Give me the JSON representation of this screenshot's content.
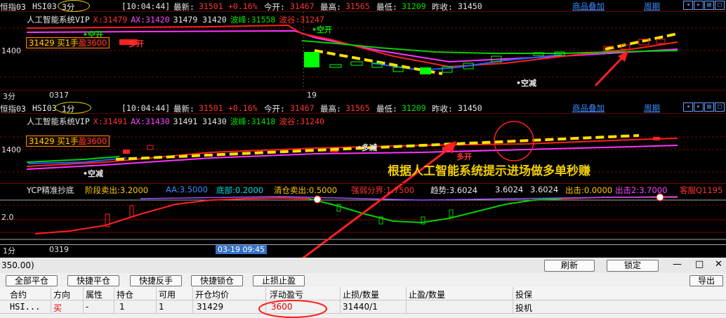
{
  "top_chart": {
    "header": {
      "symbol": "恒指03",
      "code": "HSI03",
      "period": "3分",
      "time": "[10:04:44]",
      "latest_label": "最新:",
      "latest": "31501",
      "change": "+0.16%",
      "open_label": "今开:",
      "open": "31467",
      "high_label": "最高:",
      "high": "31565",
      "low_label": "最低:",
      "low": "31209",
      "prev_label": "昨收:",
      "prev": "31450",
      "overlay_link": "商品叠加",
      "cycle_link": "周期"
    },
    "legend": {
      "name": "人工智能系统VIP",
      "x": "X:31479",
      "ax": "AX:31420",
      "vals": "31479 31420",
      "peak": "波峰:31558",
      "trough": "波谷:31247"
    },
    "position": {
      "price": "31429",
      "action": "买1手",
      "profit": "盈3600"
    },
    "y_label": "1400",
    "period_label": "3分",
    "date1": "0317",
    "date2": "19",
    "annotations": {
      "kong_kai_1": "•空开",
      "kong_kai_2": "•空开",
      "duo_kai": "多开",
      "kong_jian": "•空减"
    }
  },
  "bottom_chart": {
    "header": {
      "symbol": "恒指03",
      "code": "HSI03",
      "period": "1分",
      "time": "[10:04:44]",
      "latest_label": "最新:",
      "latest": "31501",
      "change": "+0.16%",
      "open_label": "今开:",
      "open": "31467",
      "high_label": "最高:",
      "high": "31565",
      "low_label": "最低:",
      "low": "31209",
      "prev_label": "昨收:",
      "prev": "31450",
      "overlay_link": "商品叠加",
      "cycle_link": "周期"
    },
    "legend": {
      "name": "人工智能系统VIP",
      "x": "X:31491",
      "ax": "AX:31430",
      "vals": "31491 31430",
      "peak": "波峰:31418",
      "trough": "波谷:31240"
    },
    "position": {
      "price": "31429",
      "action": "买1手",
      "profit": "盈3600"
    },
    "y_label": "1400",
    "y2_label": "2.0",
    "period_label": "1分",
    "date1": "0319",
    "date_highlight": "03-19 09:45",
    "annotations": {
      "kong_jian": "•空减",
      "duo_jian": "•多减",
      "duo_kai": "多开"
    },
    "big_annotation": "根据人工智能系统提示进场做多单秒赚",
    "indicator": {
      "name": "YCP精准抄底",
      "stage_sell": "阶段卖出:3.2000",
      "aa": "AA:3.5000",
      "bottom": "底部:0.2000",
      "clear_sell": "清仓卖出:0.5000",
      "strong_weak": "强弱分界:1.7500",
      "trend": "趋势:3.6024",
      "v1": "3.6024",
      "v2": "3.6024",
      "out": "出击:0.0000",
      "out2": "出击2:3.7000",
      "tail": "客服Q1195"
    }
  },
  "trade_panel": {
    "account_value": "350.00)",
    "refresh": "刷新",
    "lock": "锁定",
    "export": "导出",
    "buttons": [
      "全部平仓",
      "快捷平仓",
      "快捷反手",
      "快捷锁仓",
      "止损止盈"
    ],
    "columns": [
      "合约",
      "方向",
      "属性",
      "持仓",
      "可用",
      "开仓均价",
      "浮动盈亏",
      "止损/数量",
      "止盈/数量",
      "投保"
    ],
    "rows": [
      [
        "HSI...",
        "买",
        "-",
        "1",
        "1",
        "31429",
        "3600",
        "31440/1",
        "",
        "投机"
      ]
    ]
  }
}
